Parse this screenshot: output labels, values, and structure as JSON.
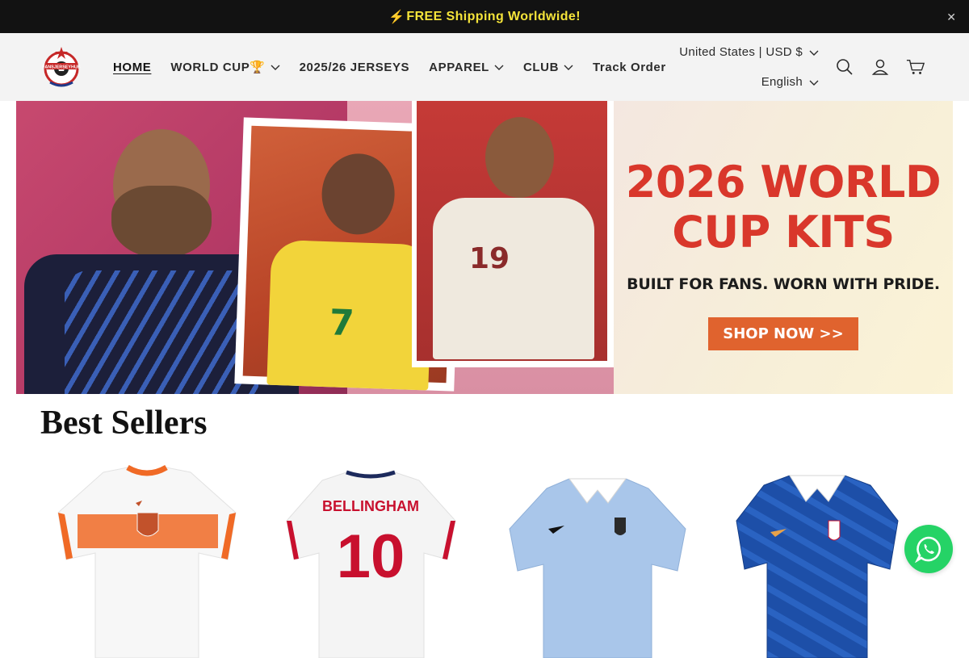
{
  "announcement": {
    "icon": "lightning-icon",
    "text": "FREE Shipping Worldwide!"
  },
  "header": {
    "logo_text": "FANSJERSEYHUB",
    "nav": [
      {
        "label": "HOME",
        "active": true,
        "dropdown": false
      },
      {
        "label": "WORLD CUP🏆",
        "active": false,
        "dropdown": true
      },
      {
        "label": "2025/26 JERSEYS",
        "active": false,
        "dropdown": false
      },
      {
        "label": "APPAREL",
        "active": false,
        "dropdown": true
      },
      {
        "label": "CLUB",
        "active": false,
        "dropdown": true
      },
      {
        "label": "Track Order",
        "active": false,
        "dropdown": false
      }
    ],
    "currency": "United States | USD $",
    "language": "English"
  },
  "hero": {
    "title": "2026 WORLD\nCUP KITS",
    "subtitle": "BUILT FOR FANS. WORN WITH PRIDE.",
    "cta": "SHOP NOW >>",
    "jersey_numbers": [
      "7",
      "19"
    ],
    "colors": {
      "title": "#d9372b",
      "cta_bg": "#e0632e"
    }
  },
  "best_sellers": {
    "title": "Best Sellers",
    "products": [
      {
        "name": "Netherlands white away jersey",
        "color": "#f7f7f7",
        "accent": "#f06a26"
      },
      {
        "name": "England home jersey",
        "color": "#f4f4f4",
        "accent": "#c8102e",
        "print_name": "BELLINGHAM",
        "number": "10"
      },
      {
        "name": "Uruguay light blue jersey",
        "color": "#a9c6ea",
        "accent": "#1b2a4a"
      },
      {
        "name": "France blue jersey",
        "color": "#1d4fa8",
        "accent": "#e8a24a"
      }
    ]
  },
  "accent_colors": {
    "announce_bg": "#121212",
    "announce_text": "#f5e43a",
    "whatsapp": "#25d366"
  }
}
